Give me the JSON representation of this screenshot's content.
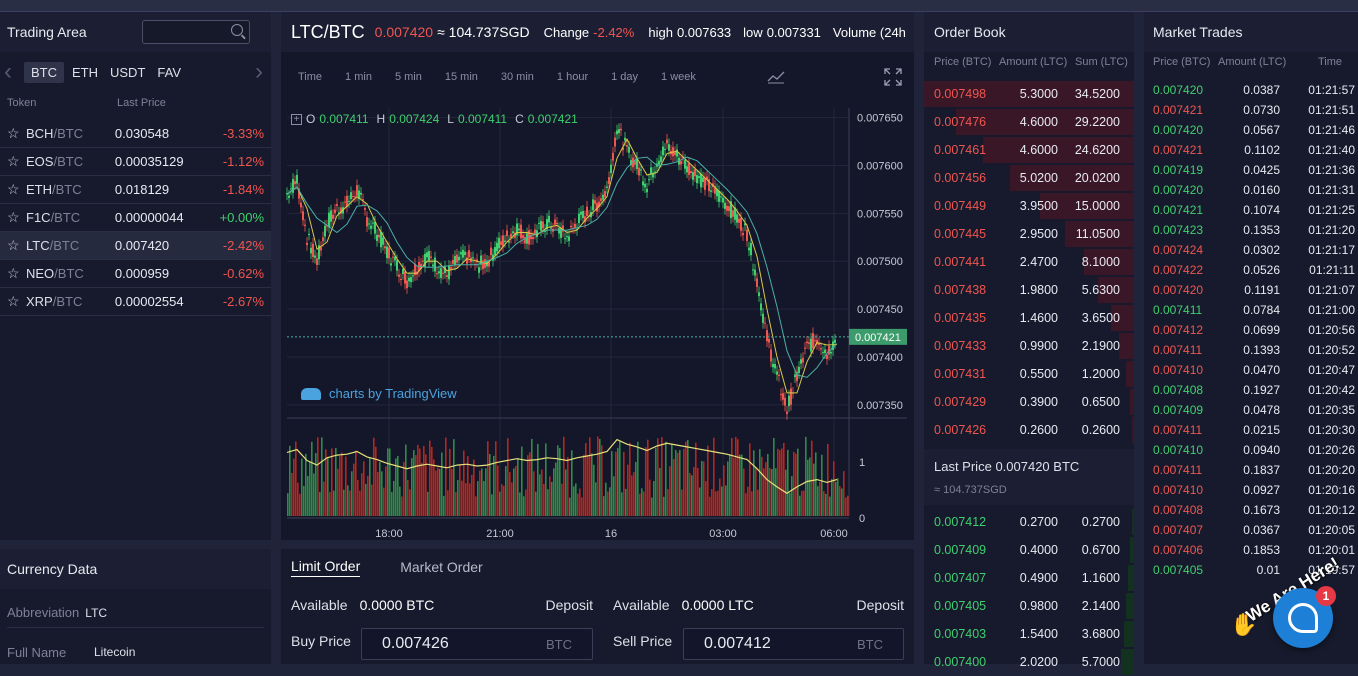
{
  "trading_area": {
    "title": "Trading Area",
    "search_placeholder": "",
    "tabs": [
      "BTC",
      "ETH",
      "USDT",
      "FAV"
    ],
    "active_tab": 0,
    "col_token": "Token",
    "col_price": "Last Price",
    "tokens": [
      {
        "base": "BCH",
        "quote": "/BTC",
        "price": "0.030548",
        "change": "-3.33%",
        "dir": "down"
      },
      {
        "base": "EOS",
        "quote": "/BTC",
        "price": "0.00035129",
        "change": "-1.12%",
        "dir": "down"
      },
      {
        "base": "ETH",
        "quote": "/BTC",
        "price": "0.018129",
        "change": "-1.84%",
        "dir": "down"
      },
      {
        "base": "F1C",
        "quote": "/BTC",
        "price": "0.00000044",
        "change": "+0.00%",
        "dir": "up"
      },
      {
        "base": "LTC",
        "quote": "/BTC",
        "price": "0.007420",
        "change": "-2.42%",
        "dir": "down",
        "selected": true
      },
      {
        "base": "NEO",
        "quote": "/BTC",
        "price": "0.000959",
        "change": "-0.62%",
        "dir": "down"
      },
      {
        "base": "XRP",
        "quote": "/BTC",
        "price": "0.00002554",
        "change": "-2.67%",
        "dir": "down"
      }
    ]
  },
  "currency_data": {
    "title": "Currency Data",
    "abbr_label": "Abbreviation",
    "abbr_value": "LTC",
    "fullname_label": "Full Name",
    "fullname_value": "Litecoin"
  },
  "ticker": {
    "pair": "LTC/BTC",
    "price": "0.007420",
    "approx": "≈ 104.737SGD",
    "change_label": "Change",
    "change_value": "-2.42%",
    "high_label": "high",
    "high_value": "0.007633",
    "low_label": "low",
    "low_value": "0.007331",
    "volume_label": "Volume (24h"
  },
  "chart_toolbar": {
    "timeframes": [
      "Time",
      "1 min",
      "5 min",
      "15 min",
      "30 min",
      "1 hour",
      "1 day",
      "1 week"
    ],
    "ohlc": {
      "o_label": "O",
      "o": "0.007411",
      "h_label": "H",
      "h": "0.007424",
      "l_label": "L",
      "l": "0.007411",
      "c_label": "C",
      "c": "0.007421"
    },
    "watermark": "charts by TradingView"
  },
  "chart_data": {
    "type": "line",
    "ylim": [
      0.00733,
      0.00766
    ],
    "y_ticks": [
      "0.007650",
      "0.007600",
      "0.007550",
      "0.007500",
      "0.007450",
      "0.007400",
      "0.007350"
    ],
    "last_price_label": "0.007421",
    "x_ticks": [
      "18:00",
      "21:00",
      "16",
      "03:00",
      "06:00"
    ],
    "volume_ticks": [
      "1",
      "0"
    ],
    "series": [
      {
        "values": [
          0.00757,
          0.007585,
          0.007525,
          0.0075,
          0.00754,
          0.007555,
          0.00756,
          0.007575,
          0.007545,
          0.00753,
          0.00751,
          0.007495,
          0.00748,
          0.007495,
          0.007505,
          0.007495,
          0.007485,
          0.0075,
          0.007505,
          0.007495,
          0.0075,
          0.007515,
          0.007525,
          0.007535,
          0.007525,
          0.00753,
          0.00754,
          0.007535,
          0.007525,
          0.00754,
          0.00755,
          0.00756,
          0.007575,
          0.00764,
          0.007615,
          0.0076,
          0.00758,
          0.007605,
          0.00762,
          0.00761,
          0.0076,
          0.00759,
          0.00758,
          0.00757,
          0.00756,
          0.007545,
          0.00753,
          0.00748,
          0.00742,
          0.00738,
          0.007345,
          0.00738,
          0.00741,
          0.00742,
          0.007405,
          0.007421
        ]
      }
    ]
  },
  "order_book": {
    "title": "Order Book",
    "col_price": "Price (BTC)",
    "col_amount": "Amount (LTC)",
    "col_sum": "Sum (LTC)",
    "asks": [
      {
        "price": "0.007498",
        "amount": "5.3000",
        "sum": "34.5200",
        "depth": 1.0
      },
      {
        "price": "0.007476",
        "amount": "4.6000",
        "sum": "29.2200",
        "depth": 0.85
      },
      {
        "price": "0.007461",
        "amount": "4.6000",
        "sum": "24.6200",
        "depth": 0.72
      },
      {
        "price": "0.007456",
        "amount": "5.0200",
        "sum": "20.0200",
        "depth": 0.59
      },
      {
        "price": "0.007449",
        "amount": "3.9500",
        "sum": "15.0000",
        "depth": 0.45
      },
      {
        "price": "0.007445",
        "amount": "2.9500",
        "sum": "11.0500",
        "depth": 0.33
      },
      {
        "price": "0.007441",
        "amount": "2.4700",
        "sum": "8.1000",
        "depth": 0.24
      },
      {
        "price": "0.007438",
        "amount": "1.9800",
        "sum": "5.6300",
        "depth": 0.17
      },
      {
        "price": "0.007435",
        "amount": "1.4600",
        "sum": "3.6500",
        "depth": 0.11
      },
      {
        "price": "0.007433",
        "amount": "0.9900",
        "sum": "2.1900",
        "depth": 0.07
      },
      {
        "price": "0.007431",
        "amount": "0.5500",
        "sum": "1.2000",
        "depth": 0.04
      },
      {
        "price": "0.007429",
        "amount": "0.3900",
        "sum": "0.6500",
        "depth": 0.02
      },
      {
        "price": "0.007426",
        "amount": "0.2600",
        "sum": "0.2600",
        "depth": 0.01
      }
    ],
    "last_price_label": "Last Price",
    "last_price_value": "0.007420 BTC",
    "last_price_fiat": "≈ 104.737SGD",
    "bids": [
      {
        "price": "0.007412",
        "amount": "0.2700",
        "sum": "0.2700",
        "depth": 0.01
      },
      {
        "price": "0.007409",
        "amount": "0.4000",
        "sum": "0.6700",
        "depth": 0.02
      },
      {
        "price": "0.007407",
        "amount": "0.4900",
        "sum": "1.1600",
        "depth": 0.03
      },
      {
        "price": "0.007405",
        "amount": "0.9800",
        "sum": "2.1400",
        "depth": 0.04
      },
      {
        "price": "0.007403",
        "amount": "1.5400",
        "sum": "3.6800",
        "depth": 0.05
      },
      {
        "price": "0.007400",
        "amount": "2.0200",
        "sum": "5.7000",
        "depth": 0.06
      }
    ]
  },
  "market_trades": {
    "title": "Market Trades",
    "col_price": "Price (BTC)",
    "col_amount": "Amount (LTC)",
    "col_time": "Time",
    "trades": [
      {
        "price": "0.007420",
        "amount": "0.0387",
        "time": "01:21:57",
        "side": "buy"
      },
      {
        "price": "0.007421",
        "amount": "0.0730",
        "time": "01:21:51",
        "side": "sell"
      },
      {
        "price": "0.007420",
        "amount": "0.0567",
        "time": "01:21:46",
        "side": "buy"
      },
      {
        "price": "0.007421",
        "amount": "0.1102",
        "time": "01:21:40",
        "side": "sell"
      },
      {
        "price": "0.007419",
        "amount": "0.0425",
        "time": "01:21:36",
        "side": "buy"
      },
      {
        "price": "0.007420",
        "amount": "0.0160",
        "time": "01:21:31",
        "side": "buy"
      },
      {
        "price": "0.007421",
        "amount": "0.1074",
        "time": "01:21:25",
        "side": "buy"
      },
      {
        "price": "0.007423",
        "amount": "0.1353",
        "time": "01:21:20",
        "side": "buy"
      },
      {
        "price": "0.007424",
        "amount": "0.0302",
        "time": "01:21:17",
        "side": "sell"
      },
      {
        "price": "0.007422",
        "amount": "0.0526",
        "time": "01:21:11",
        "side": "sell"
      },
      {
        "price": "0.007420",
        "amount": "0.1191",
        "time": "01:21:07",
        "side": "sell"
      },
      {
        "price": "0.007411",
        "amount": "0.0784",
        "time": "01:21:00",
        "side": "buy"
      },
      {
        "price": "0.007412",
        "amount": "0.0699",
        "time": "01:20:56",
        "side": "sell"
      },
      {
        "price": "0.007411",
        "amount": "0.1393",
        "time": "01:20:52",
        "side": "sell"
      },
      {
        "price": "0.007410",
        "amount": "0.0470",
        "time": "01:20:47",
        "side": "sell"
      },
      {
        "price": "0.007408",
        "amount": "0.1927",
        "time": "01:20:42",
        "side": "buy"
      },
      {
        "price": "0.007409",
        "amount": "0.0478",
        "time": "01:20:35",
        "side": "buy"
      },
      {
        "price": "0.007411",
        "amount": "0.0215",
        "time": "01:20:30",
        "side": "sell"
      },
      {
        "price": "0.007410",
        "amount": "0.0940",
        "time": "01:20:26",
        "side": "buy"
      },
      {
        "price": "0.007411",
        "amount": "0.1837",
        "time": "01:20:20",
        "side": "sell"
      },
      {
        "price": "0.007410",
        "amount": "0.0927",
        "time": "01:20:16",
        "side": "sell"
      },
      {
        "price": "0.007408",
        "amount": "0.1673",
        "time": "01:20:12",
        "side": "sell"
      },
      {
        "price": "0.007407",
        "amount": "0.0367",
        "time": "01:20:05",
        "side": "sell"
      },
      {
        "price": "0.007406",
        "amount": "0.1853",
        "time": "01:20:01",
        "side": "sell"
      },
      {
        "price": "0.007405",
        "amount": "0.01",
        "time": "01:19:57",
        "side": "buy"
      }
    ]
  },
  "order_form": {
    "tab_limit": "Limit Order",
    "tab_market": "Market Order",
    "available_label": "Available",
    "buy_available": "0.0000 BTC",
    "sell_available": "0.0000 LTC",
    "deposit_label": "Deposit",
    "buy_price_label": "Buy Price",
    "buy_price_value": "0.007426",
    "buy_unit": "BTC",
    "sell_price_label": "Sell Price",
    "sell_price_value": "0.007412",
    "sell_unit": "BTC"
  },
  "chat_widget": {
    "banner": "We Are Here!",
    "badge": "1"
  },
  "colors": {
    "up": "#3ed06e",
    "down": "#f0554f",
    "accent": "#1e7fd6",
    "panel": "#171a2c"
  }
}
